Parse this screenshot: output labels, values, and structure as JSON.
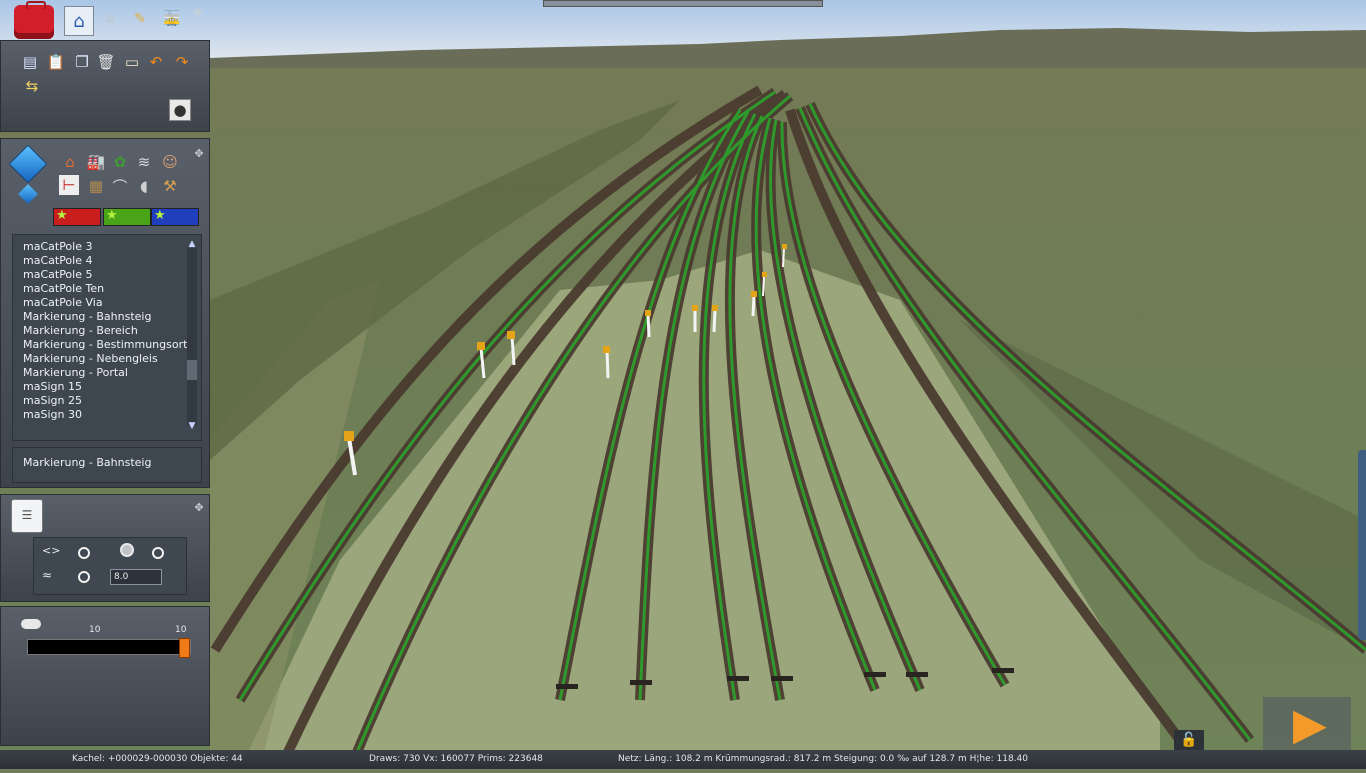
{
  "toolbar_top": {
    "icons": [
      "toolbox-icon",
      "home-icon",
      "track-icon",
      "brush-icon",
      "train-icon"
    ]
  },
  "edit_panel": {
    "icons": [
      "file-icon",
      "paste-icon",
      "copy-icon",
      "delete-icon",
      "measure-icon",
      "undo-icon",
      "redo-icon",
      "snap-icon",
      "camera-icon"
    ]
  },
  "object_panel": {
    "categories_row1": [
      "house-icon",
      "industry-icon",
      "tree-icon",
      "splines-icon",
      "figure-icon"
    ],
    "categories_row2": [
      "signal-icon",
      "track-object-icon",
      "bridge-icon",
      "sound-icon",
      "tool-icon"
    ],
    "star_colors": [
      "#c81e1e",
      "#4aa418",
      "#1f3fbd"
    ]
  },
  "asset_list": {
    "items": [
      "maCatPole 3",
      "maCatPole 4",
      "maCatPole 5",
      "maCatPole Ten",
      "maCatPole Via",
      "Markierung - Bahnsteig",
      "Markierung - Bereich",
      "Markierung - Bestimmungsort",
      "Markierung - Nebengleis",
      "Markierung - Portal",
      "maSign 15",
      "maSign 25",
      "maSign 30"
    ],
    "selected": "Markierung - Bahnsteig",
    "scroll_up": "▲",
    "scroll_down": "▼"
  },
  "options_panel": {
    "height_value": "8.0"
  },
  "slider_panel": {
    "left_value": "10",
    "right_value": "10",
    "level": 1.0
  },
  "status_bar": {
    "tile": "Kachel: +000029-000030  Objekte: 44",
    "draws": "Draws: 730 Vx: 160077 Prims: 223648",
    "net": "Netz:  Läng.:  108.2 m Krümmungsrad.: 817.2 m Steigung:  0.0 ‰ auf 128.7 m H¦he: 118.40"
  },
  "play_button": "▶",
  "lock_icon": "🔓"
}
